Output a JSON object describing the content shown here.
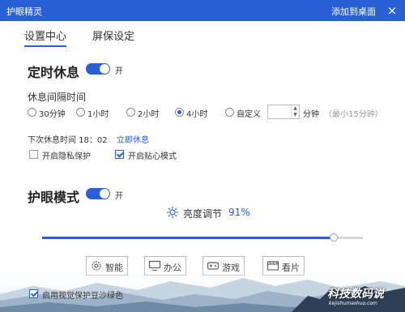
{
  "titlebar": {
    "title": "护眼精灵",
    "add_to_desktop": "添加到桌面",
    "close_symbol": "×"
  },
  "tabs": [
    {
      "label": "设置中心",
      "active": true
    },
    {
      "label": "屏保设定",
      "active": false
    }
  ],
  "rest_timer": {
    "title": "定时休息",
    "toggle_on": true,
    "toggle_label": "开",
    "interval_heading": "休息间隔时间",
    "options": [
      {
        "label": "30分钟",
        "checked": false
      },
      {
        "label": "1小时",
        "checked": false
      },
      {
        "label": "2小时",
        "checked": false
      },
      {
        "label": "4小时",
        "checked": true
      },
      {
        "label": "自定义",
        "checked": false
      }
    ],
    "custom_value": "",
    "custom_unit": "分钟",
    "custom_hint": "（最小15分钟）",
    "next_rest_label": "下次休息时间 18：02",
    "rest_now_link": "立即休息",
    "privacy_label": "开启隐私保护",
    "privacy_checked": false,
    "care_label": "开启贴心模式",
    "care_checked": true
  },
  "eye_mode": {
    "title": "护眼模式",
    "toggle_on": true,
    "toggle_label": "开",
    "brightness_label": "亮度调节",
    "brightness_value": "91%",
    "brightness_level": 0.91,
    "modes": [
      {
        "label": "智能",
        "icon": "gear-icon"
      },
      {
        "label": "办公",
        "icon": "monitor-icon"
      },
      {
        "label": "游戏",
        "icon": "gamepad-icon"
      },
      {
        "label": "看片",
        "icon": "film-icon"
      }
    ]
  },
  "footer": {
    "green_protect_label": "启用视觉保护豆沙绿色",
    "green_protect_checked": true
  },
  "watermark": {
    "cn": "科技数码说",
    "en": "kejishumashuo.com"
  },
  "colors": {
    "accent": "#2a60d6",
    "titlebar": "#2a60d6"
  }
}
